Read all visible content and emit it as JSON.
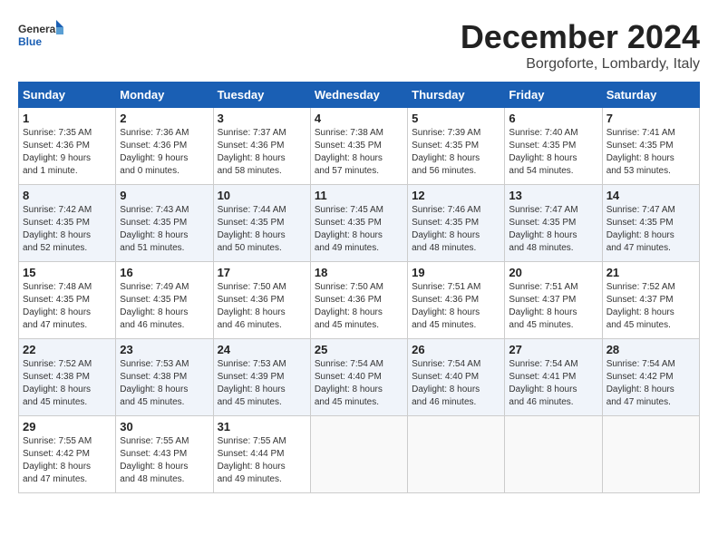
{
  "logo": {
    "line1": "General",
    "line2": "Blue"
  },
  "title": "December 2024",
  "location": "Borgoforte, Lombardy, Italy",
  "headers": [
    "Sunday",
    "Monday",
    "Tuesday",
    "Wednesday",
    "Thursday",
    "Friday",
    "Saturday"
  ],
  "weeks": [
    [
      {
        "day": "1",
        "info": "Sunrise: 7:35 AM\nSunset: 4:36 PM\nDaylight: 9 hours\nand 1 minute."
      },
      {
        "day": "2",
        "info": "Sunrise: 7:36 AM\nSunset: 4:36 PM\nDaylight: 9 hours\nand 0 minutes."
      },
      {
        "day": "3",
        "info": "Sunrise: 7:37 AM\nSunset: 4:36 PM\nDaylight: 8 hours\nand 58 minutes."
      },
      {
        "day": "4",
        "info": "Sunrise: 7:38 AM\nSunset: 4:35 PM\nDaylight: 8 hours\nand 57 minutes."
      },
      {
        "day": "5",
        "info": "Sunrise: 7:39 AM\nSunset: 4:35 PM\nDaylight: 8 hours\nand 56 minutes."
      },
      {
        "day": "6",
        "info": "Sunrise: 7:40 AM\nSunset: 4:35 PM\nDaylight: 8 hours\nand 54 minutes."
      },
      {
        "day": "7",
        "info": "Sunrise: 7:41 AM\nSunset: 4:35 PM\nDaylight: 8 hours\nand 53 minutes."
      }
    ],
    [
      {
        "day": "8",
        "info": "Sunrise: 7:42 AM\nSunset: 4:35 PM\nDaylight: 8 hours\nand 52 minutes."
      },
      {
        "day": "9",
        "info": "Sunrise: 7:43 AM\nSunset: 4:35 PM\nDaylight: 8 hours\nand 51 minutes."
      },
      {
        "day": "10",
        "info": "Sunrise: 7:44 AM\nSunset: 4:35 PM\nDaylight: 8 hours\nand 50 minutes."
      },
      {
        "day": "11",
        "info": "Sunrise: 7:45 AM\nSunset: 4:35 PM\nDaylight: 8 hours\nand 49 minutes."
      },
      {
        "day": "12",
        "info": "Sunrise: 7:46 AM\nSunset: 4:35 PM\nDaylight: 8 hours\nand 48 minutes."
      },
      {
        "day": "13",
        "info": "Sunrise: 7:47 AM\nSunset: 4:35 PM\nDaylight: 8 hours\nand 48 minutes."
      },
      {
        "day": "14",
        "info": "Sunrise: 7:47 AM\nSunset: 4:35 PM\nDaylight: 8 hours\nand 47 minutes."
      }
    ],
    [
      {
        "day": "15",
        "info": "Sunrise: 7:48 AM\nSunset: 4:35 PM\nDaylight: 8 hours\nand 47 minutes."
      },
      {
        "day": "16",
        "info": "Sunrise: 7:49 AM\nSunset: 4:35 PM\nDaylight: 8 hours\nand 46 minutes."
      },
      {
        "day": "17",
        "info": "Sunrise: 7:50 AM\nSunset: 4:36 PM\nDaylight: 8 hours\nand 46 minutes."
      },
      {
        "day": "18",
        "info": "Sunrise: 7:50 AM\nSunset: 4:36 PM\nDaylight: 8 hours\nand 45 minutes."
      },
      {
        "day": "19",
        "info": "Sunrise: 7:51 AM\nSunset: 4:36 PM\nDaylight: 8 hours\nand 45 minutes."
      },
      {
        "day": "20",
        "info": "Sunrise: 7:51 AM\nSunset: 4:37 PM\nDaylight: 8 hours\nand 45 minutes."
      },
      {
        "day": "21",
        "info": "Sunrise: 7:52 AM\nSunset: 4:37 PM\nDaylight: 8 hours\nand 45 minutes."
      }
    ],
    [
      {
        "day": "22",
        "info": "Sunrise: 7:52 AM\nSunset: 4:38 PM\nDaylight: 8 hours\nand 45 minutes."
      },
      {
        "day": "23",
        "info": "Sunrise: 7:53 AM\nSunset: 4:38 PM\nDaylight: 8 hours\nand 45 minutes."
      },
      {
        "day": "24",
        "info": "Sunrise: 7:53 AM\nSunset: 4:39 PM\nDaylight: 8 hours\nand 45 minutes."
      },
      {
        "day": "25",
        "info": "Sunrise: 7:54 AM\nSunset: 4:40 PM\nDaylight: 8 hours\nand 45 minutes."
      },
      {
        "day": "26",
        "info": "Sunrise: 7:54 AM\nSunset: 4:40 PM\nDaylight: 8 hours\nand 46 minutes."
      },
      {
        "day": "27",
        "info": "Sunrise: 7:54 AM\nSunset: 4:41 PM\nDaylight: 8 hours\nand 46 minutes."
      },
      {
        "day": "28",
        "info": "Sunrise: 7:54 AM\nSunset: 4:42 PM\nDaylight: 8 hours\nand 47 minutes."
      }
    ],
    [
      {
        "day": "29",
        "info": "Sunrise: 7:55 AM\nSunset: 4:42 PM\nDaylight: 8 hours\nand 47 minutes."
      },
      {
        "day": "30",
        "info": "Sunrise: 7:55 AM\nSunset: 4:43 PM\nDaylight: 8 hours\nand 48 minutes."
      },
      {
        "day": "31",
        "info": "Sunrise: 7:55 AM\nSunset: 4:44 PM\nDaylight: 8 hours\nand 49 minutes."
      },
      {
        "day": "",
        "info": ""
      },
      {
        "day": "",
        "info": ""
      },
      {
        "day": "",
        "info": ""
      },
      {
        "day": "",
        "info": ""
      }
    ]
  ]
}
